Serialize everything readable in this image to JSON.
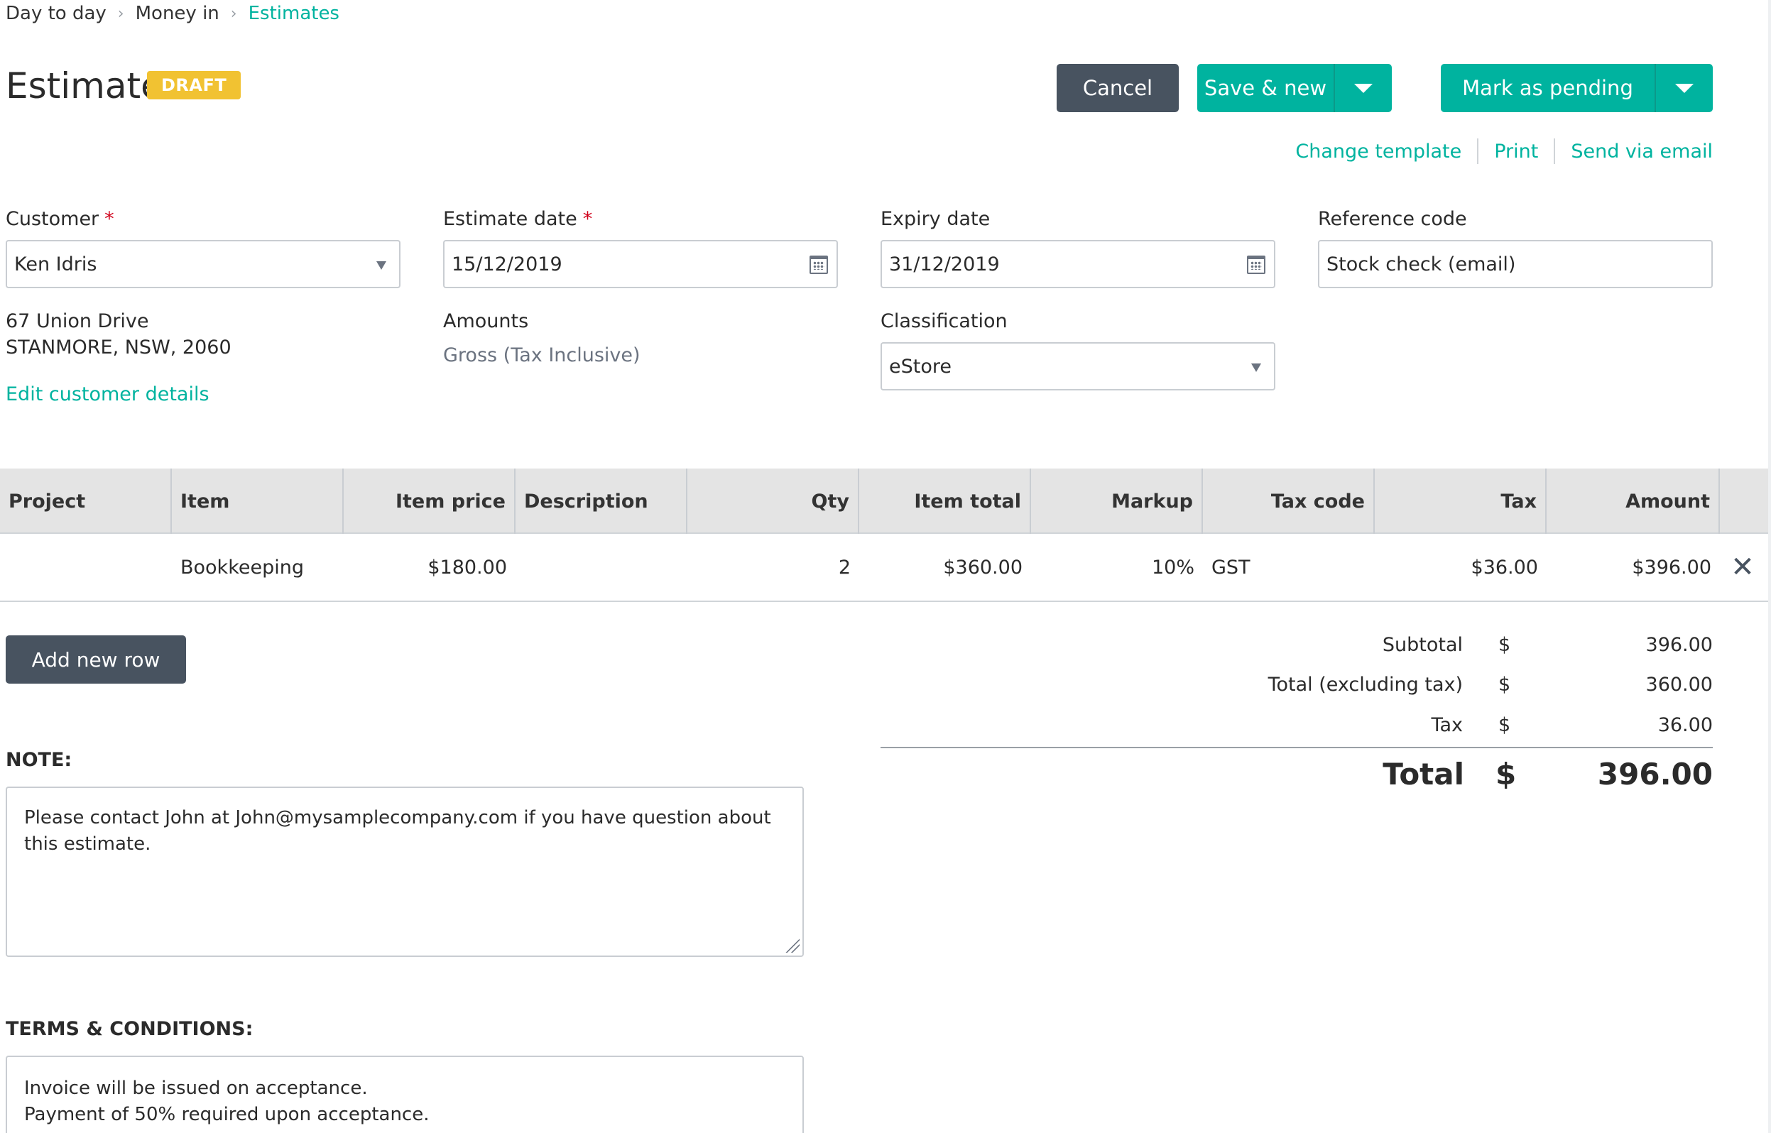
{
  "breadcrumb": [
    "Day to day",
    "Money in",
    "Estimates"
  ],
  "title": "Estimate",
  "status_badge": "DRAFT",
  "buttons": {
    "cancel": "Cancel",
    "save_new": "Save & new",
    "mark_pending": "Mark as pending",
    "add_row": "Add new row"
  },
  "links": {
    "change_template": "Change template",
    "print": "Print",
    "send_email": "Send via email",
    "edit_customer": "Edit customer details"
  },
  "form": {
    "customer_label": "Customer",
    "customer_value": "Ken Idris",
    "estimate_date_label": "Estimate date",
    "estimate_date_value": "15/12/2019",
    "expiry_date_label": "Expiry date",
    "expiry_date_value": "31/12/2019",
    "reference_label": "Reference code",
    "reference_value": "Stock check (email)",
    "address_line1": "67 Union Drive",
    "address_line2": "STANMORE, NSW, 2060",
    "amounts_label": "Amounts",
    "amounts_value": "Gross (Tax Inclusive)",
    "classification_label": "Classification",
    "classification_value": "eStore"
  },
  "table": {
    "columns": [
      "Project",
      "Item",
      "Item price",
      "Description",
      "Qty",
      "Item total",
      "Markup",
      "Tax code",
      "Tax",
      "Amount"
    ],
    "rows": [
      {
        "project": "",
        "item": "Bookkeeping",
        "item_price": "$180.00",
        "description": "",
        "qty": "2",
        "item_total": "$360.00",
        "markup": "10%",
        "tax_code": "GST",
        "tax": "$36.00",
        "amount": "$396.00"
      }
    ]
  },
  "totals": {
    "subtotal_label": "Subtotal",
    "subtotal_currency": "$",
    "subtotal_value": "396.00",
    "excl_label": "Total (excluding tax)",
    "excl_currency": "$",
    "excl_value": "360.00",
    "tax_label": "Tax",
    "tax_currency": "$",
    "tax_value": "36.00",
    "total_label": "Total",
    "total_currency": "$",
    "total_value": "396.00"
  },
  "note": {
    "title": "NOTE:",
    "text": "Please contact John at John@mysamplecompany.com if you have question about this estimate."
  },
  "terms": {
    "title": "TERMS & CONDITIONS:",
    "line1": "Invoice will be issued on acceptance.",
    "line2": "Payment of 50% required upon acceptance."
  },
  "colors": {
    "accent": "#00b39f",
    "dark_button": "#485360",
    "badge": "#f1c232",
    "required": "#d0021b"
  }
}
